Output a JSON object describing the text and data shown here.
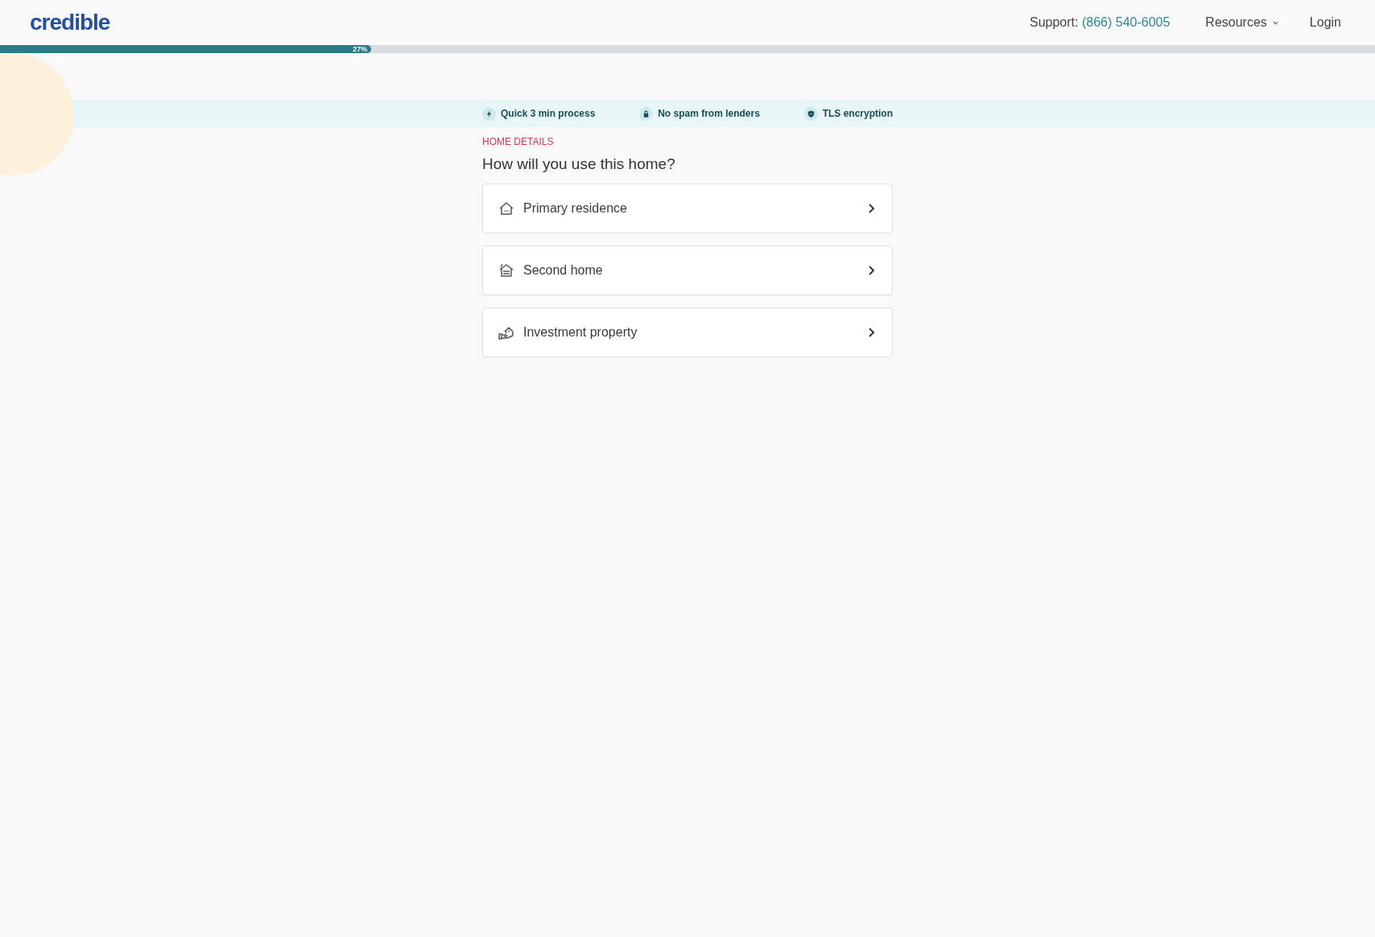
{
  "header": {
    "logo": "credible",
    "support_label": "Support:",
    "support_phone": "(866) 540-6005",
    "nav": [
      {
        "label": "Resources",
        "kind": "dropdown"
      },
      {
        "label": "Login",
        "kind": "link"
      }
    ]
  },
  "progress": {
    "level": 0.27,
    "label": "27%"
  },
  "trust_items": [
    {
      "kind": "bolt",
      "label": "Quick 3 min process"
    },
    {
      "kind": "lock",
      "label": "No spam from lenders"
    },
    {
      "kind": "shield",
      "label": "TLS encryption"
    }
  ],
  "section_label": "HOME DETAILS",
  "question": "How will you use this home?",
  "options": [
    {
      "kind": "house",
      "label": "Primary residence"
    },
    {
      "kind": "second-home",
      "label": "Second home"
    },
    {
      "kind": "investment",
      "label": "Investment property"
    }
  ]
}
